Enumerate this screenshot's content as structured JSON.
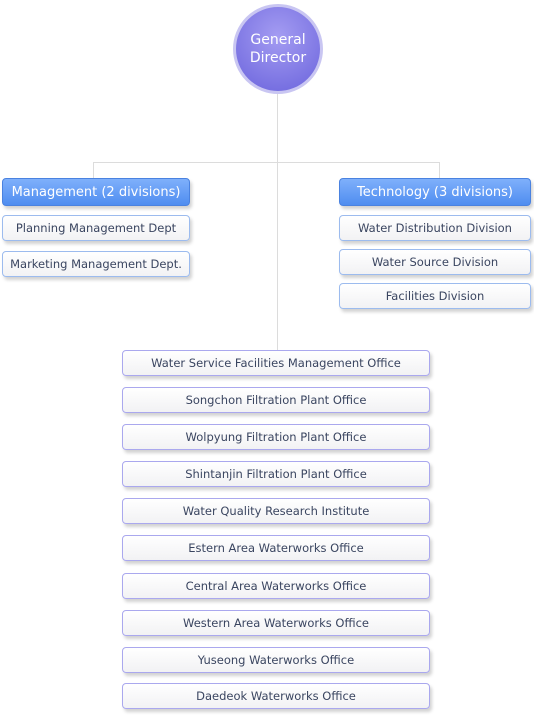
{
  "director": {
    "line1": "General",
    "line2": "Director"
  },
  "management": {
    "title": "Management (2 divisions)",
    "items": [
      "Planning Management Dept",
      "Marketing Management Dept."
    ]
  },
  "technology": {
    "title": "Technology (3 divisions)",
    "items": [
      "Water Distribution Division",
      "Water Source Division",
      "Facilities Division"
    ]
  },
  "offices": [
    "Water Service Facilities Management Office",
    "Songchon Filtration Plant Office",
    "Wolpyung Filtration Plant Office",
    "Shintanjin Filtration Plant Office",
    "Water Quality Research Institute",
    "Estern Area Waterworks Office",
    "Central Area Waterworks Office",
    "Western Area Waterworks Office",
    "Yuseong Waterworks Office",
    "Daedeok Waterworks Office"
  ],
  "colors": {
    "director": "#7a72e6",
    "header": "#5f9af5",
    "text": "#3a4560"
  }
}
